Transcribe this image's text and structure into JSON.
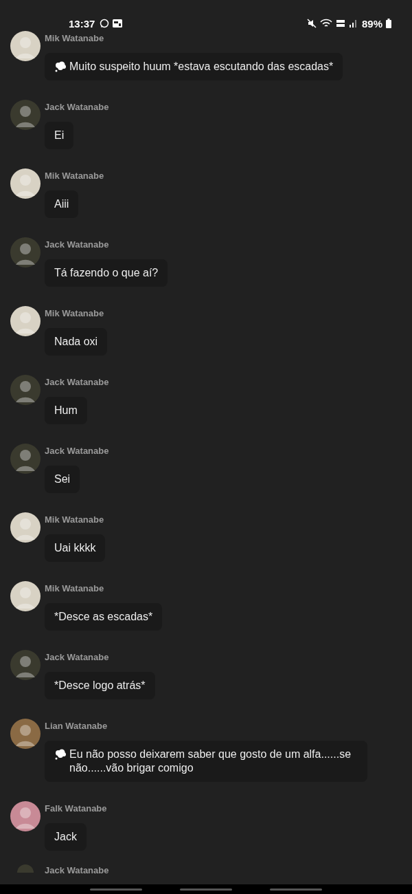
{
  "status_bar": {
    "time": "13:37",
    "battery": "89%"
  },
  "messages": [
    {
      "author": "Mik Watanabe",
      "color": "#d8d2c4",
      "kind": "thought",
      "text": "Muito suspeito huum *estava escutando das escadas*"
    },
    {
      "author": "Jack Watanabe",
      "color": "#3a3a2e",
      "kind": "speech",
      "text": "Ei"
    },
    {
      "author": "Mik Watanabe",
      "color": "#d8d2c4",
      "kind": "speech",
      "text": "Aiii"
    },
    {
      "author": "Jack Watanabe",
      "color": "#3a3a2e",
      "kind": "speech",
      "text": "Tá fazendo o que aí?"
    },
    {
      "author": "Mik Watanabe",
      "color": "#d8d2c4",
      "kind": "speech",
      "text": "Nada oxi"
    },
    {
      "author": "Jack Watanabe",
      "color": "#3a3a2e",
      "kind": "speech",
      "text": "Hum"
    },
    {
      "author": "Jack Watanabe",
      "color": "#3a3a2e",
      "kind": "speech",
      "text": "Sei"
    },
    {
      "author": "Mik Watanabe",
      "color": "#d8d2c4",
      "kind": "speech",
      "text": "Uai kkkk"
    },
    {
      "author": "Mik Watanabe",
      "color": "#d8d2c4",
      "kind": "speech",
      "text": "*Desce as escadas*"
    },
    {
      "author": "Jack Watanabe",
      "color": "#3a3a2e",
      "kind": "speech",
      "text": "*Desce logo atrás*"
    },
    {
      "author": "Lian Watanabe",
      "color": "#8a6a44",
      "kind": "thought",
      "text": "Eu não posso deixarem saber que gosto de um alfa......se não......vão brigar comigo"
    },
    {
      "author": "Falk Watanabe",
      "color": "#c88a96",
      "kind": "speech",
      "text": "Jack"
    }
  ],
  "next_author": "Jack Watanabe"
}
